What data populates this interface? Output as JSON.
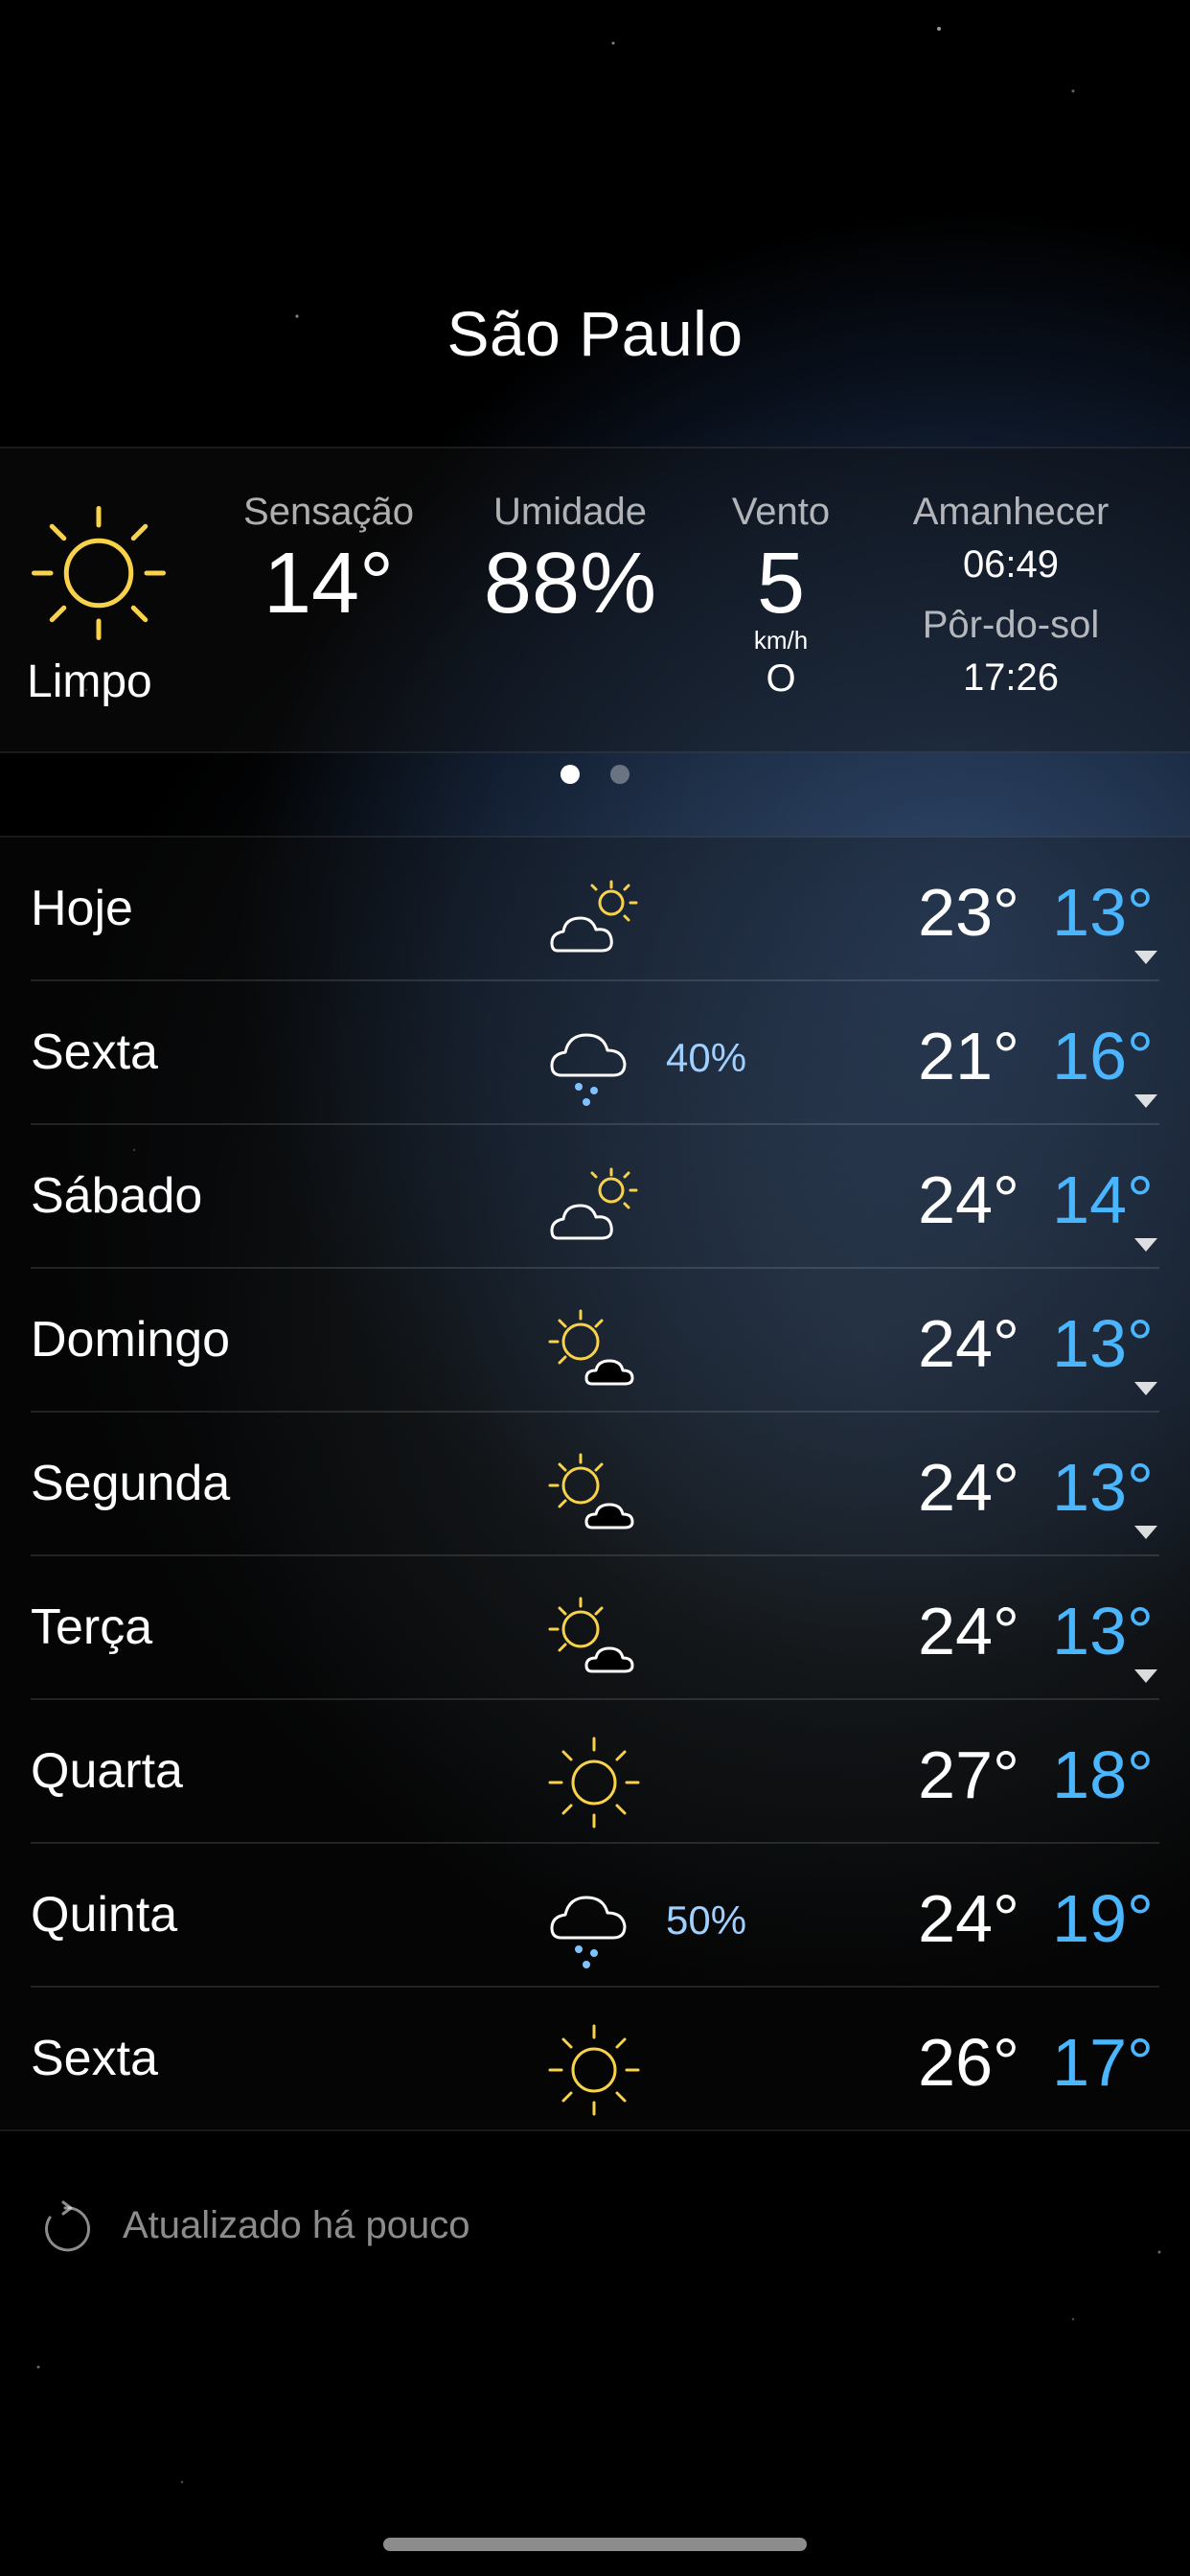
{
  "city": "São Paulo",
  "current": {
    "condition": "Limpo",
    "condition_icon": "sun-icon",
    "feels_like_label": "Sensação",
    "feels_like_value": "14°",
    "humidity_label": "Umidade",
    "humidity_value": "88%",
    "wind_label": "Vento",
    "wind_value": "5",
    "wind_unit": "km/h",
    "wind_dir": "O",
    "sunrise_label": "Amanhecer",
    "sunrise_time": "06:49",
    "sunset_label": "Pôr-do-sol",
    "sunset_time": "17:26"
  },
  "pagination": {
    "pages": 2,
    "active": 1
  },
  "forecast": [
    {
      "day": "Hoje",
      "icon": "partly-cloudy-icon",
      "pop": "",
      "hi": "23°",
      "lo": "13°",
      "expand": true
    },
    {
      "day": "Sexta",
      "icon": "rain-icon",
      "pop": "40%",
      "hi": "21°",
      "lo": "16°",
      "expand": true
    },
    {
      "day": "Sábado",
      "icon": "partly-cloudy-icon",
      "pop": "",
      "hi": "24°",
      "lo": "14°",
      "expand": true
    },
    {
      "day": "Domingo",
      "icon": "sun-cloud-icon",
      "pop": "",
      "hi": "24°",
      "lo": "13°",
      "expand": true
    },
    {
      "day": "Segunda",
      "icon": "sun-cloud-icon",
      "pop": "",
      "hi": "24°",
      "lo": "13°",
      "expand": true
    },
    {
      "day": "Terça",
      "icon": "sun-cloud-icon",
      "pop": "",
      "hi": "24°",
      "lo": "13°",
      "expand": true
    },
    {
      "day": "Quarta",
      "icon": "sun-icon",
      "pop": "",
      "hi": "27°",
      "lo": "18°",
      "expand": false
    },
    {
      "day": "Quinta",
      "icon": "rain-icon",
      "pop": "50%",
      "hi": "24°",
      "lo": "19°",
      "expand": false
    },
    {
      "day": "Sexta",
      "icon": "sun-icon",
      "pop": "",
      "hi": "26°",
      "lo": "17°",
      "expand": false
    }
  ],
  "updated_text": "Atualizado há pouco",
  "colors": {
    "sun": "#f7d24a",
    "low_temp": "#49b6ff",
    "pop": "#9fd0ff"
  }
}
